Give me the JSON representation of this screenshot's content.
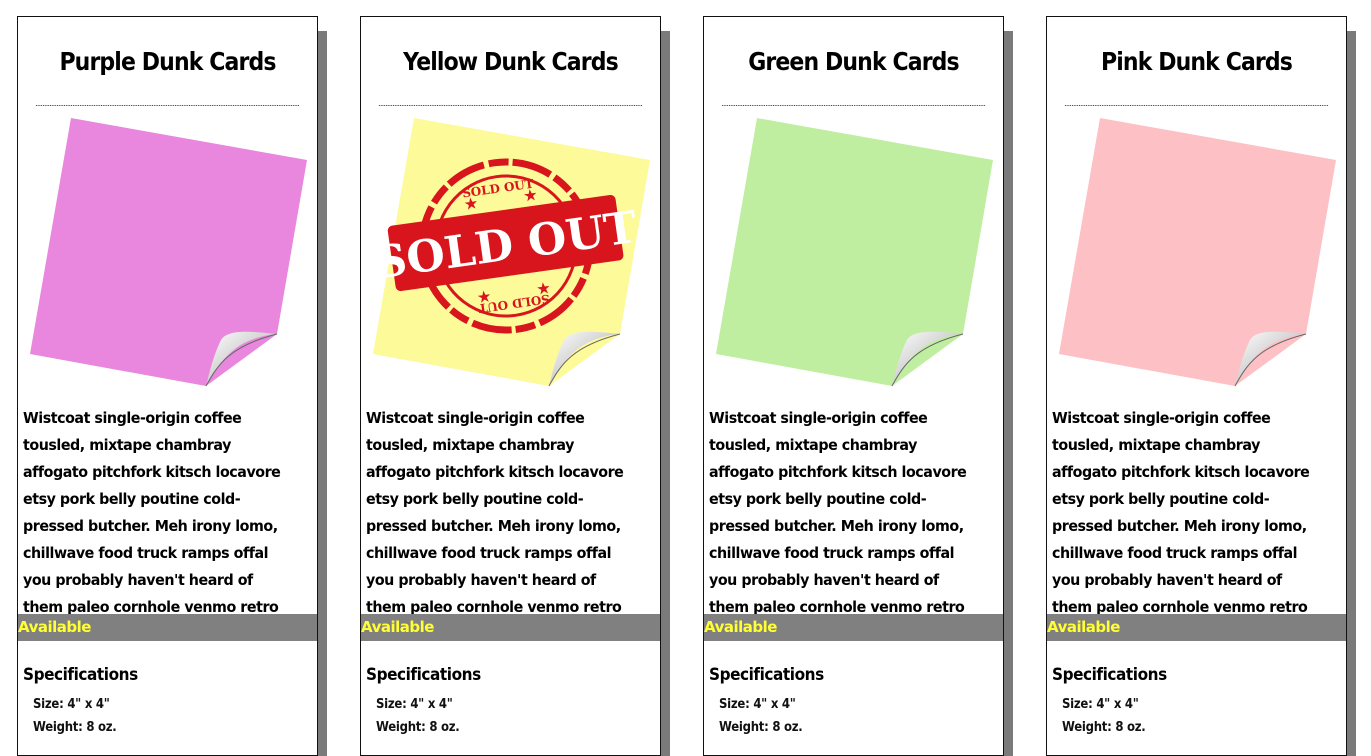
{
  "cards": [
    {
      "title": "Purple Dunk Cards",
      "note_color": "#e887dd",
      "description": "Wistcoat single-origin coffee tousled, mixtape chambray affogato pitchfork kitsch locavore etsy pork belly poutine cold-pressed butcher. Meh irony lomo, chillwave food truck ramps offal you probably haven't heard of them paleo cornhole venmo retro",
      "status": "Available",
      "specs_title": "Specifications",
      "size": "Size: 4\" x 4\"",
      "weight": "Weight: 8 oz.",
      "sold_out": false
    },
    {
      "title": "Yellow Dunk Cards",
      "note_color": "#fdfa9a",
      "description": "Wistcoat single-origin coffee tousled, mixtape chambray affogato pitchfork kitsch locavore etsy pork belly poutine cold-pressed butcher. Meh irony lomo, chillwave food truck ramps offal you probably haven't heard of them paleo cornhole venmo retro",
      "status": "Available",
      "specs_title": "Specifications",
      "size": "Size: 4\" x 4\"",
      "weight": "Weight: 8 oz.",
      "sold_out": true,
      "stamp_text": "SOLD OUT",
      "stamp_small_text": "SOLD OUT"
    },
    {
      "title": "Green Dunk Cards",
      "note_color": "#c0eea0",
      "description": "Wistcoat single-origin coffee tousled, mixtape chambray affogato pitchfork kitsch locavore etsy pork belly poutine cold-pressed butcher. Meh irony lomo, chillwave food truck ramps offal you probably haven't heard of them paleo cornhole venmo retro",
      "status": "Available",
      "specs_title": "Specifications",
      "size": "Size: 4\" x 4\"",
      "weight": "Weight: 8 oz.",
      "sold_out": false
    },
    {
      "title": "Pink Dunk Cards",
      "note_color": "#fdc0c5",
      "description": "Wistcoat single-origin coffee tousled, mixtape chambray affogato pitchfork kitsch locavore etsy pork belly poutine cold-pressed butcher. Meh irony lomo, chillwave food truck ramps offal you probably haven't heard of them paleo cornhole venmo retro",
      "status": "Available",
      "specs_title": "Specifications",
      "size": "Size: 4\" x 4\"",
      "weight": "Weight: 8 oz.",
      "sold_out": false
    }
  ],
  "colors": {
    "status_bar": "#808080",
    "status_text": "#ffff33",
    "shadow": "#7a7a7a",
    "stamp_red": "#d8141c"
  },
  "icons": {
    "note": "sticky-note-icon",
    "stamp": "sold-out-stamp-icon"
  }
}
